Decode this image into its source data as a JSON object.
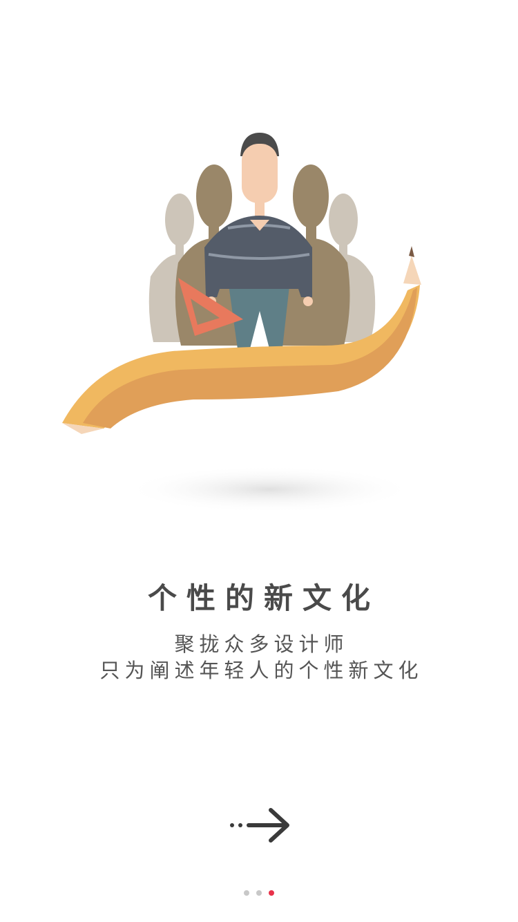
{
  "illustration": {
    "icon": "people-on-pencil-illustration"
  },
  "content": {
    "title": "个性的新文化",
    "subtitle_line1": "聚拢众多设计师",
    "subtitle_line2": "只为阐述年轻人的个性新文化"
  },
  "navigation": {
    "next_icon": "dotted-arrow-right-icon"
  },
  "pagination": {
    "total_pages": 3,
    "current_page": 3,
    "active_color": "#e8324a",
    "inactive_color": "#c8c8c8"
  },
  "colors": {
    "background": "#ffffff",
    "text": "#4a4a4a",
    "pencil": "#f0b860"
  }
}
